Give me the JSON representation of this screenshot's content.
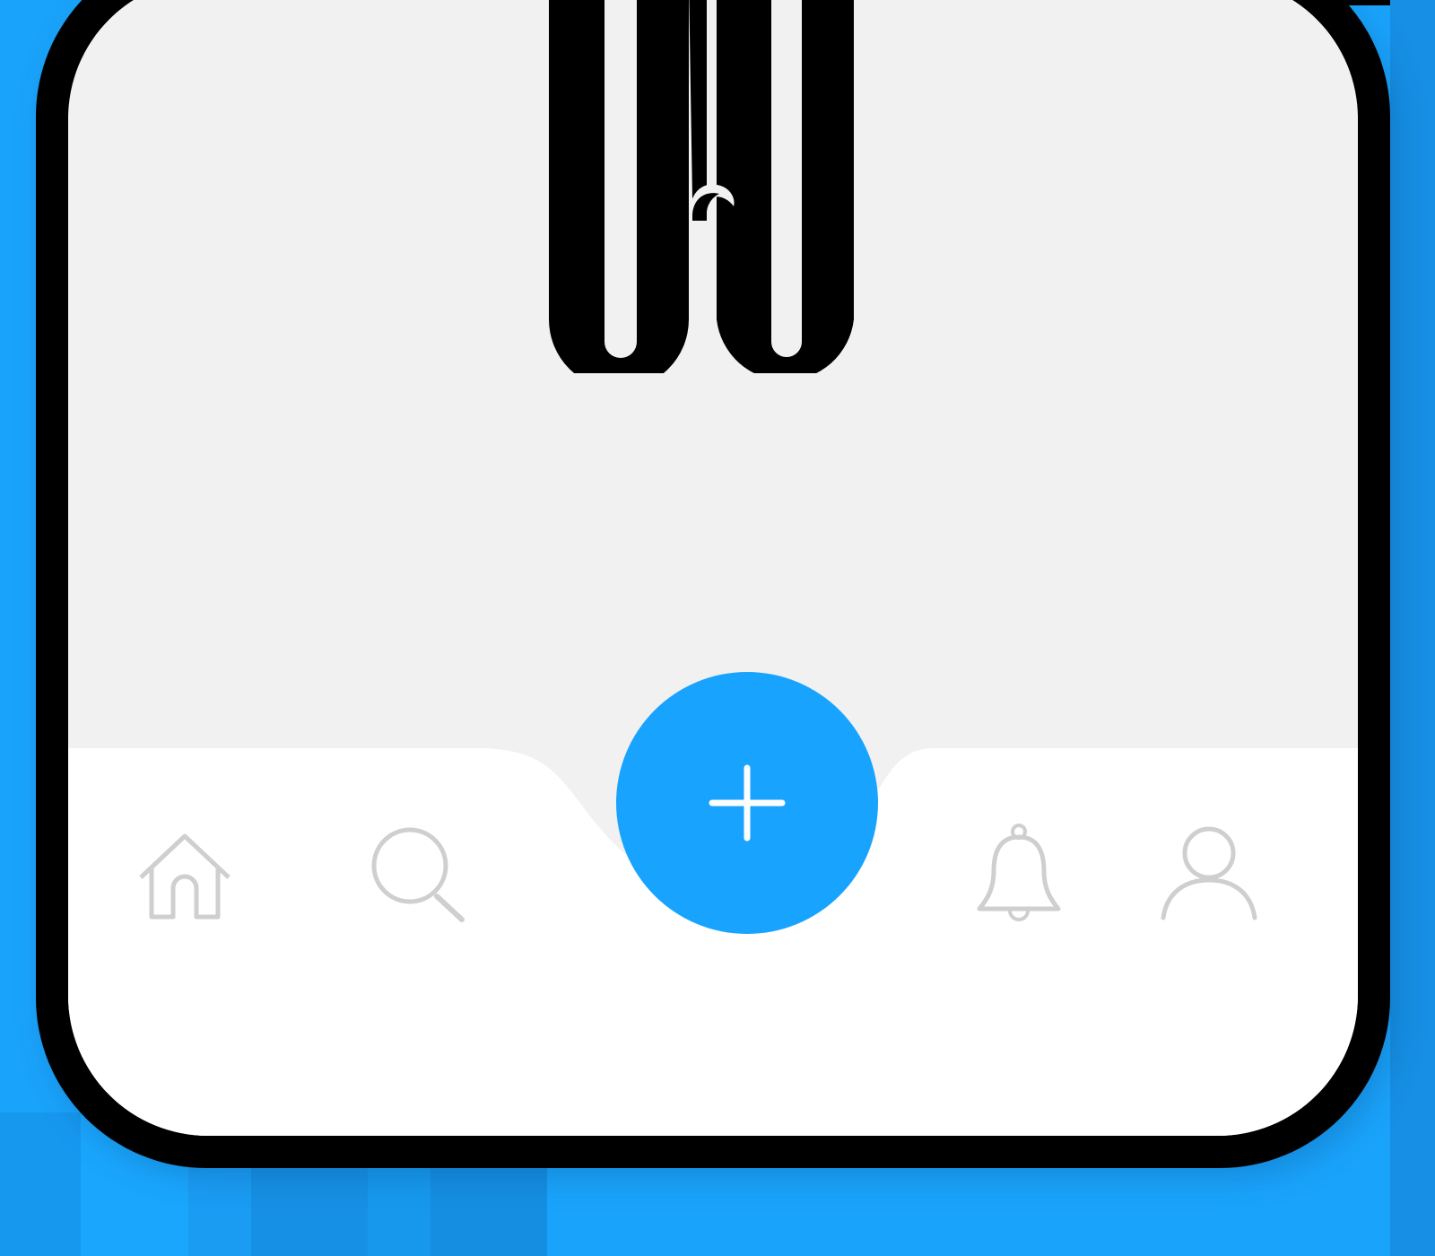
{
  "theme": {
    "background": "#1aa3fb",
    "screen_background": "#f2f1f2",
    "bar_background": "#ffffff",
    "accent": "#18a4fe",
    "icon_color": "#cfcfcf",
    "frame": "#000000"
  },
  "illustration": {
    "name": "folded-hands-illustration"
  },
  "bottom_nav": {
    "items": [
      {
        "id": "home",
        "icon": "home-icon"
      },
      {
        "id": "search",
        "icon": "search-icon"
      },
      {
        "id": "notifications",
        "icon": "bell-icon"
      },
      {
        "id": "profile",
        "icon": "user-icon"
      }
    ],
    "fab": {
      "icon": "plus-icon",
      "symbol": "+"
    }
  }
}
